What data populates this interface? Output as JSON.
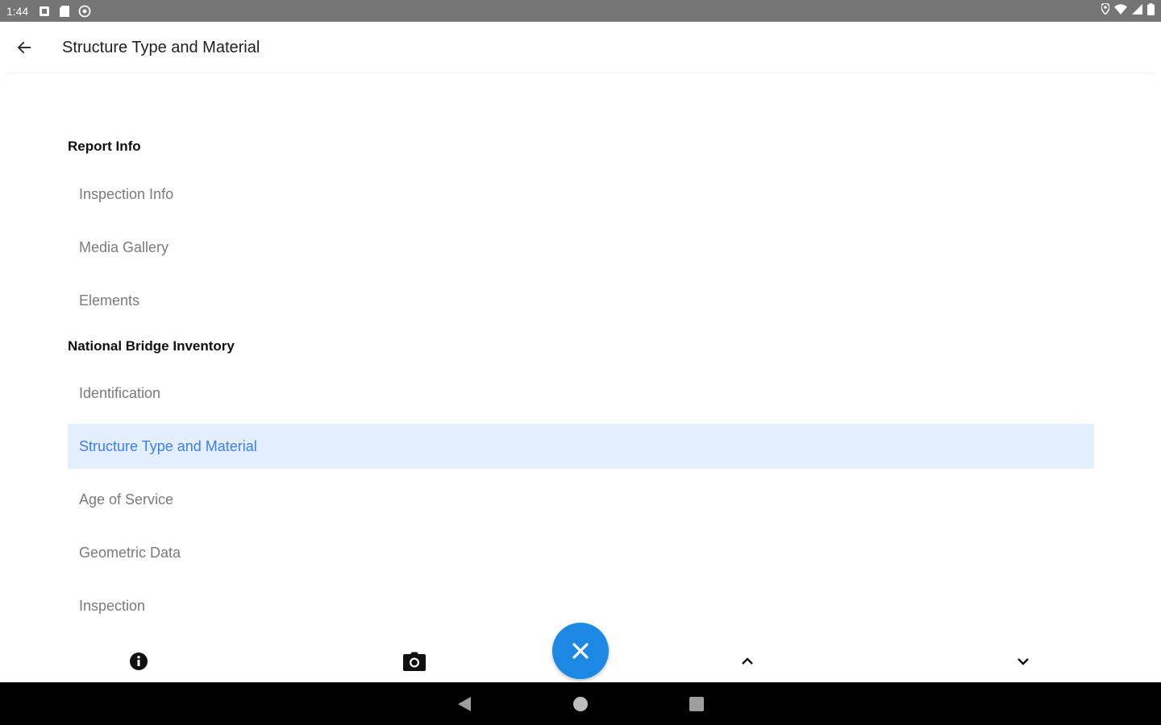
{
  "status_bar": {
    "time": "1:44",
    "left_icons": [
      "notification-icon",
      "sd-card-icon",
      "sync-icon"
    ],
    "right_icons": [
      "location-icon",
      "wifi-icon",
      "signal-icon",
      "battery-icon"
    ]
  },
  "app_bar": {
    "back_icon": "arrow-back-icon",
    "title": "Structure Type and Material"
  },
  "sections": [
    {
      "header": "Report Info",
      "items": [
        "Inspection Info",
        "Media Gallery",
        "Elements"
      ]
    },
    {
      "header": "National Bridge Inventory",
      "items": [
        "Identification",
        "Structure Type and Material",
        "Age of Service",
        "Geometric Data",
        "Inspection"
      ]
    }
  ],
  "active_item": "Structure Type and Material",
  "bottom_bar": {
    "icons": [
      "info-icon",
      "camera-icon",
      "close-icon",
      "chevron-up-icon",
      "chevron-down-icon"
    ]
  },
  "colors": {
    "accent": "#1e88e5",
    "active_bg": "#e3eefe",
    "active_text": "#3d7ff2",
    "status_bar": "#757575"
  }
}
